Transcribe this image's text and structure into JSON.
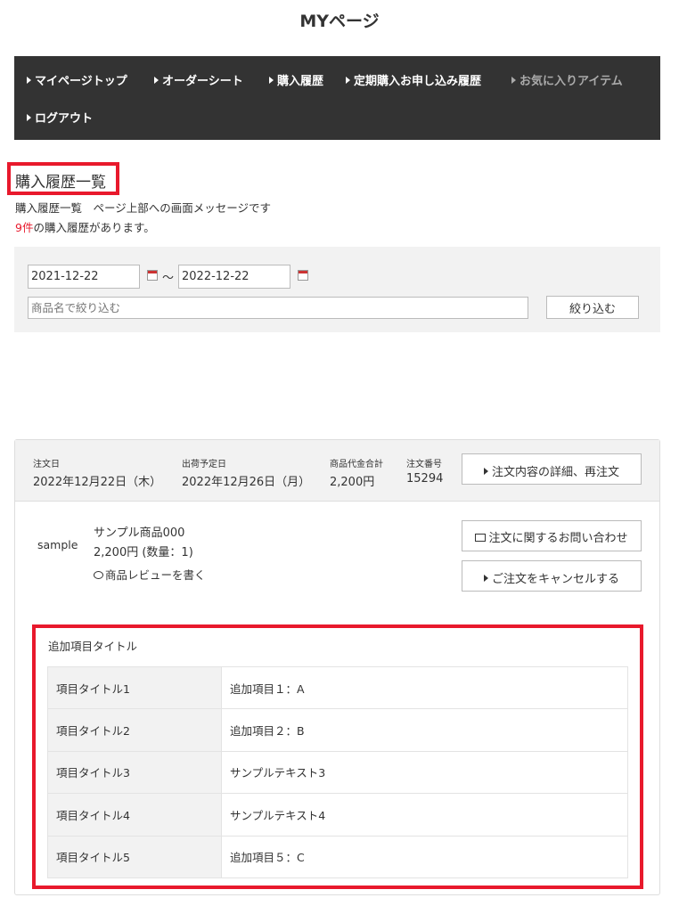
{
  "page_title": "MYページ",
  "nav": {
    "items": [
      {
        "label": "マイページトップ"
      },
      {
        "label": "オーダーシート"
      },
      {
        "label": "購入履歴"
      },
      {
        "label": "定期購入お申し込み履歴"
      },
      {
        "label": "お気に入りアイテム"
      },
      {
        "label": "ログアウト"
      }
    ]
  },
  "heading": "購入履歴一覧",
  "message": "購入履歴一覧　ページ上部への画面メッセージです",
  "count": {
    "number": "9件",
    "suffix": "の購入履歴があります。"
  },
  "filter": {
    "date_from": "2021-12-22",
    "separator": "〜",
    "date_to": "2022-12-22",
    "name_placeholder": "商品名で絞り込む",
    "submit_label": "絞り込む"
  },
  "order": {
    "order_date_label": "注文日",
    "order_date": "2022年12月22日（木）",
    "ship_date_label": "出荷予定日",
    "ship_date": "2022年12月26日（月）",
    "total_label": "商品代金合計",
    "total": "2,200円",
    "number_label": "注文番号",
    "number": "15294",
    "detail_button": "注文内容の詳細、再注文",
    "image_alt": "sample",
    "product_name": "サンプル商品000",
    "product_price": "2,200円 (数量：1)",
    "review_link": "商品レビューを書く",
    "inquiry_button": "注文に関するお問い合わせ",
    "cancel_button": "ご注文をキャンセルする"
  },
  "extra": {
    "title": "追加項目タイトル",
    "rows": [
      {
        "key": "項目タイトル1",
        "value": "追加項目１：A"
      },
      {
        "key": "項目タイトル2",
        "value": "追加項目２：B"
      },
      {
        "key": "項目タイトル3",
        "value": "サンプルテキスト3"
      },
      {
        "key": "項目タイトル4",
        "value": "サンプルテキスト4"
      },
      {
        "key": "項目タイトル5",
        "value": "追加項目５：C"
      }
    ]
  }
}
